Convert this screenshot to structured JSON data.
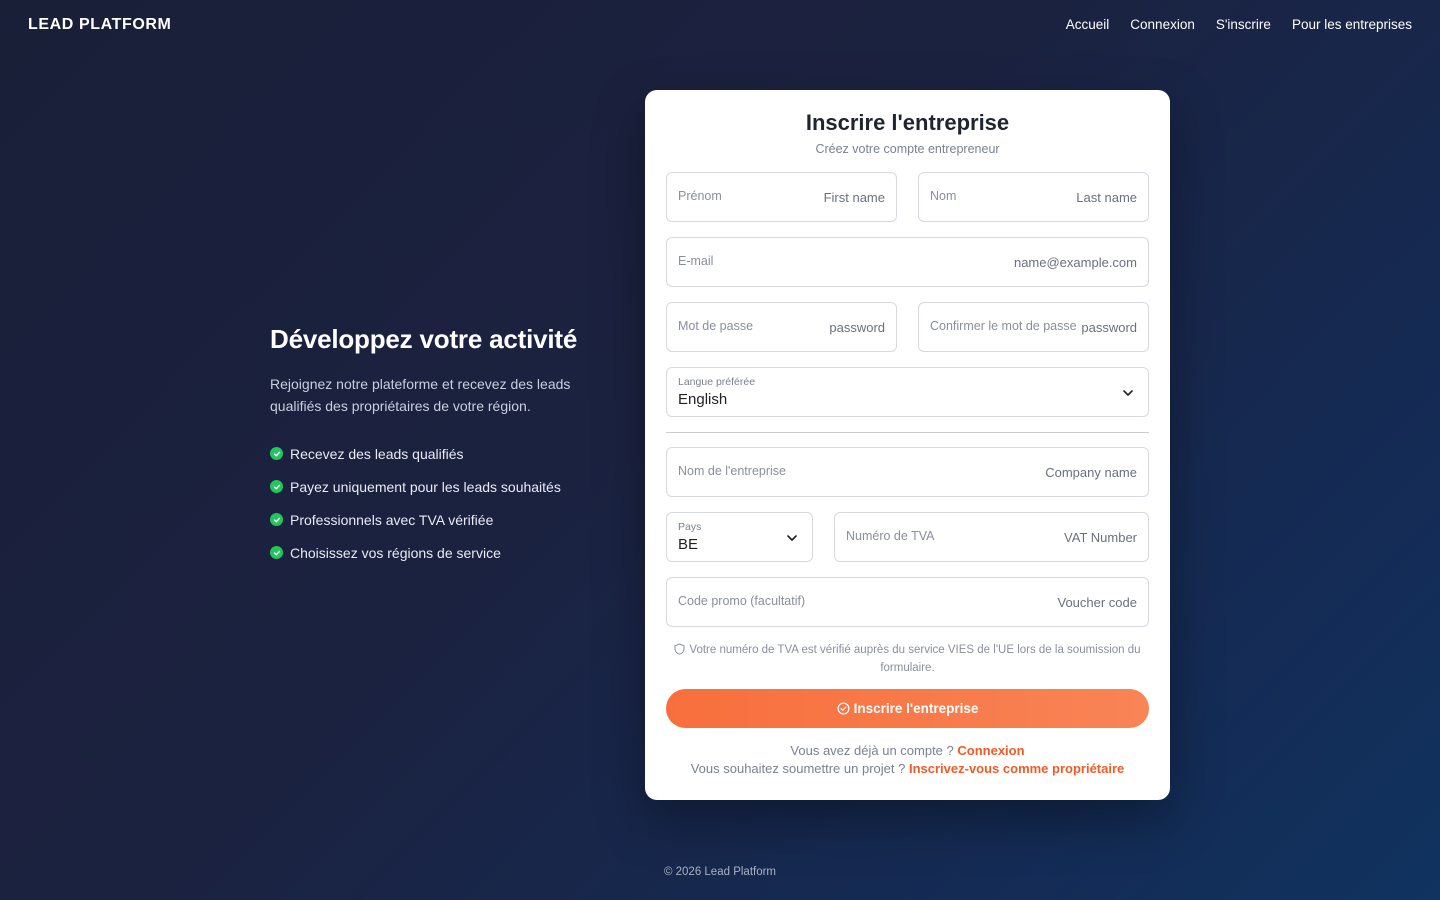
{
  "header": {
    "brand": "LEAD PLATFORM",
    "nav": [
      "Accueil",
      "Connexion",
      "S'inscrire",
      "Pour les entreprises"
    ]
  },
  "hero": {
    "title": "Développez votre activité",
    "subtitle": "Rejoignez notre plateforme et recevez des leads qualifiés des propriétaires de votre région.",
    "features": [
      "Recevez des leads qualifiés",
      "Payez uniquement pour les leads souhaités",
      "Professionnels avec TVA vérifiée",
      "Choisissez vos régions de service"
    ]
  },
  "form": {
    "title": "Inscrire l'entreprise",
    "subtitle": "Créez votre compte entrepreneur",
    "first_name": {
      "label": "Prénom",
      "placeholder": "First name",
      "value": ""
    },
    "last_name": {
      "label": "Nom",
      "placeholder": "Last name",
      "value": ""
    },
    "email": {
      "label": "E-mail",
      "placeholder": "name@example.com",
      "value": ""
    },
    "password": {
      "label": "Mot de passe",
      "placeholder": "password",
      "value": ""
    },
    "confirm_password": {
      "label": "Confirmer le mot de passe",
      "placeholder": "password",
      "value": ""
    },
    "language": {
      "label": "Langue préférée",
      "value": "English"
    },
    "company": {
      "label": "Nom de l'entreprise",
      "placeholder": "Company name",
      "value": ""
    },
    "country": {
      "label": "Pays",
      "value": "BE"
    },
    "vat": {
      "label": "Numéro de TVA",
      "placeholder": "VAT Number",
      "value": ""
    },
    "promo": {
      "label": "Code promo (facultatif)",
      "placeholder": "Voucher code",
      "value": ""
    },
    "vat_notice": "Votre numéro de TVA est vérifié auprès du service VIES de l'UE lors de la soumission du formulaire.",
    "submit_label": "Inscrire l'entreprise",
    "login_prompt": "Vous avez déjà un compte ?",
    "login_link": "Connexion",
    "owner_prompt": "Vous souhaitez soumettre un projet ?",
    "owner_link": "Inscrivez-vous comme propriétaire"
  },
  "footer": {
    "text": "© 2026 Lead Platform"
  },
  "colors": {
    "accent": "#f76f3c",
    "success": "#22c55e",
    "link": "#ef5b26",
    "background": "#1a1f38"
  }
}
